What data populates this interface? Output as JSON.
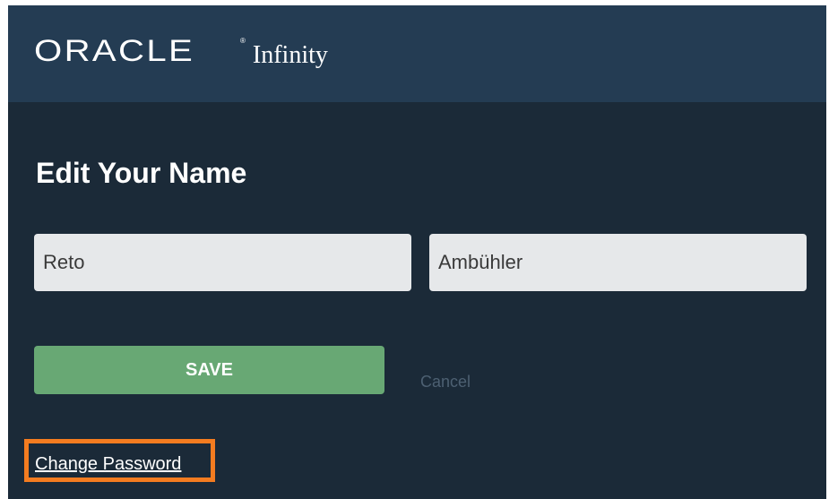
{
  "header": {
    "logo_brand": "ORACLE",
    "logo_registered": "®",
    "logo_product": "Infinity"
  },
  "form": {
    "title": "Edit Your Name",
    "first_name_value": "Reto",
    "last_name_value": "Ambühler",
    "save_label": "SAVE",
    "cancel_label": "Cancel"
  },
  "links": {
    "change_password_label": "Change Password"
  },
  "colors": {
    "page_bg": "#1b2a38",
    "header_bg": "#243c53",
    "save_button": "#68a874",
    "highlight_box": "#f47c20",
    "cancel_text": "#4d6072",
    "input_bg": "#e6e8ea"
  }
}
